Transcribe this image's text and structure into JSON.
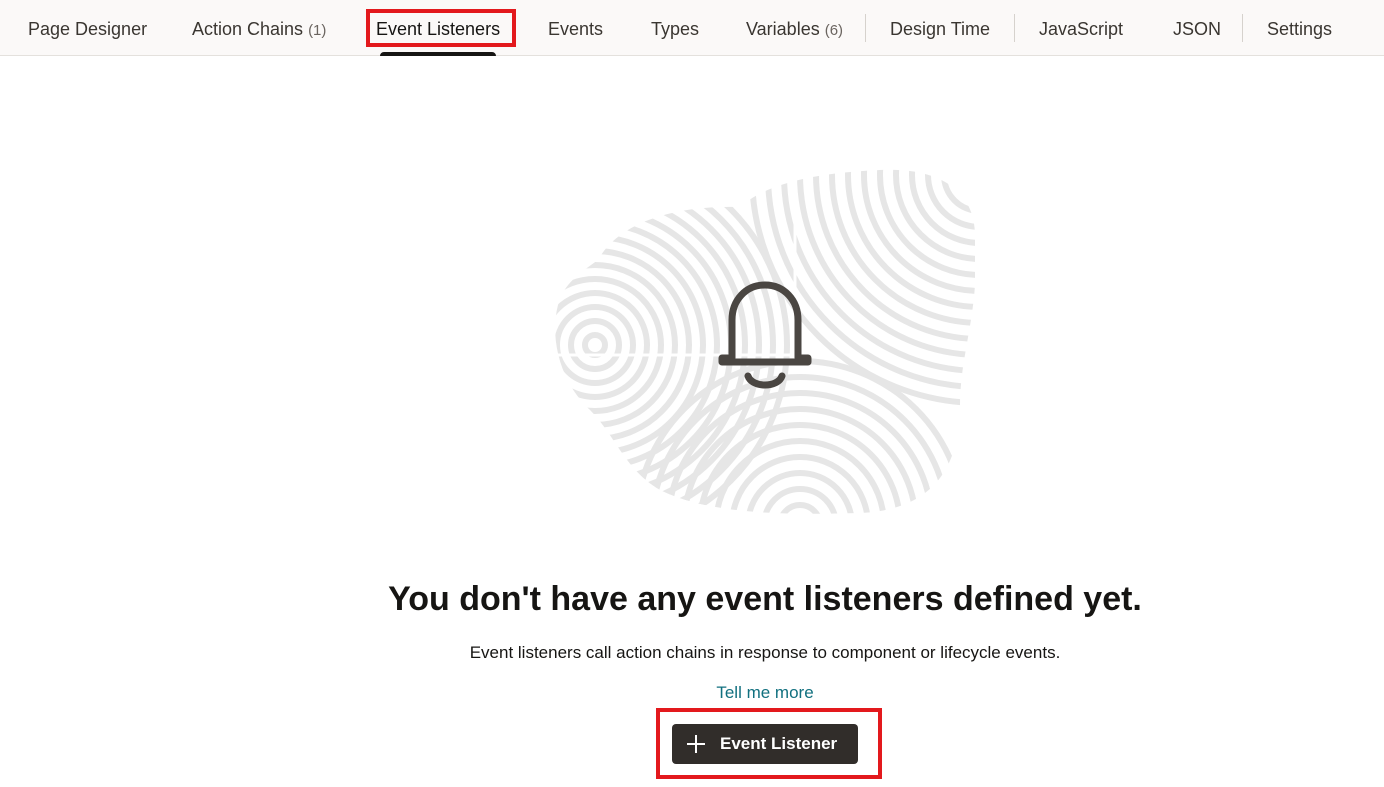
{
  "tabs": [
    {
      "label": "Page Designer",
      "count": ""
    },
    {
      "label": "Action Chains",
      "count": "(1)"
    },
    {
      "label": "Event Listeners",
      "count": "",
      "selected": true
    },
    {
      "label": "Events",
      "count": ""
    },
    {
      "label": "Types",
      "count": ""
    },
    {
      "label": "Variables",
      "count": "(6)"
    },
    {
      "label": "Design Time",
      "count": ""
    },
    {
      "label": "JavaScript",
      "count": ""
    },
    {
      "label": "JSON",
      "count": ""
    },
    {
      "label": "Settings",
      "count": ""
    }
  ],
  "empty_state": {
    "icon": "bell-icon",
    "headline": "You don't have any event listeners defined yet.",
    "description": "Event listeners call action chains in response to component or lifecycle events.",
    "link": "Tell me more",
    "button_label": "Event Listener",
    "button_icon": "plus-icon"
  },
  "colors": {
    "highlight": "#e3191d",
    "link": "#11707f",
    "button_bg": "#312d2a",
    "text": "#161513"
  }
}
